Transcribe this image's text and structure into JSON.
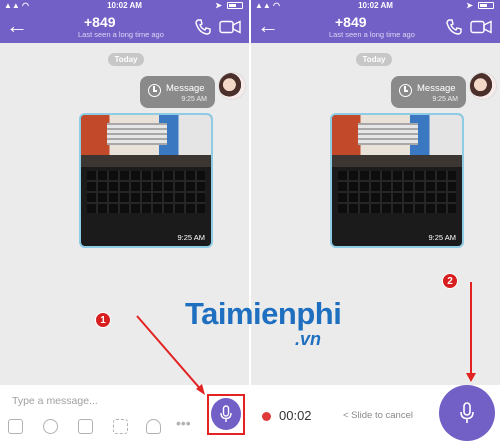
{
  "left_screen": {
    "status_time": "10:02 AM",
    "header_number": "+849",
    "header_sub": "Last seen a long time ago",
    "date_badge": "Today",
    "message_label": "Message",
    "message_time": "9:25 AM",
    "photo_time": "9:25 AM",
    "input_placeholder": "Type a message..."
  },
  "right_screen": {
    "status_time": "10:02 AM",
    "header_number": "+849",
    "header_sub": "Last seen a long time ago",
    "date_badge": "Today",
    "message_label": "Message",
    "message_time": "9:25 AM",
    "photo_time": "9:25 AM",
    "recording_time": "00:02",
    "slide_hint": "< Slide to cancel"
  },
  "annotations": {
    "step1": "1",
    "step2": "2"
  },
  "watermark": {
    "brand": "Taimienphi",
    "tld": ".vn"
  },
  "colors": {
    "viber_purple": "#7360c6",
    "annotation_red": "#e32222",
    "watermark_blue": "#1f6fc0"
  }
}
